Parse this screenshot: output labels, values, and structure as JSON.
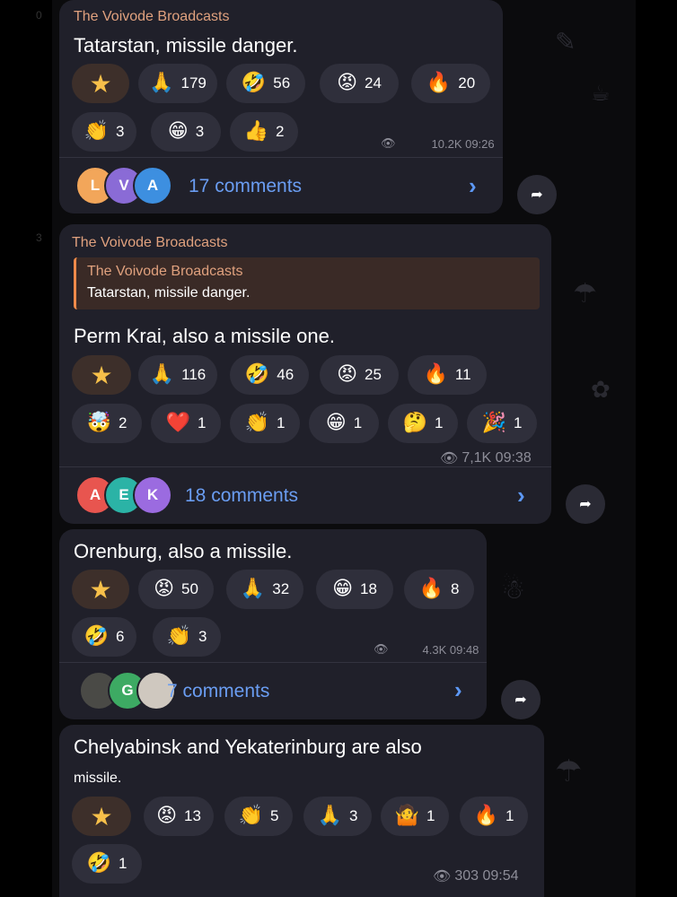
{
  "channel_name": "The Voivode Broadcasts",
  "colors": {
    "bubble": "#20202a",
    "link": "#6a9df2",
    "channel": "#e0a17e",
    "reply_bar": "#f08a4a"
  },
  "icons": {
    "star": "star-icon",
    "eye": "views-eye-icon",
    "forward": "forward-arrow-icon",
    "chevron": "chevron-right-icon"
  },
  "posts": [
    {
      "text": "Tatarstan, missile danger.",
      "reactions": [
        {
          "emoji": "⭐",
          "count": ""
        },
        {
          "emoji": "🙏",
          "count": "179"
        },
        {
          "emoji": "🤣",
          "count": "56"
        },
        {
          "emoji": "😡",
          "count": "24"
        },
        {
          "emoji": "🔥",
          "count": "20"
        },
        {
          "emoji": "👏",
          "count": "3"
        },
        {
          "emoji": "😁",
          "count": "3"
        },
        {
          "emoji": "👍",
          "count": "2"
        }
      ],
      "views": "10.2K 09:26",
      "avatars": [
        "L",
        "V",
        "A"
      ],
      "comments": "17 comments"
    },
    {
      "reply_name": "The Voivode Broadcasts",
      "reply_text": "Tatarstan, missile danger.",
      "text": "Perm Krai, also a missile one.",
      "reactions": [
        {
          "emoji": "⭐",
          "count": ""
        },
        {
          "emoji": "🙏",
          "count": "116"
        },
        {
          "emoji": "🤣",
          "count": "46"
        },
        {
          "emoji": "😡",
          "count": "25"
        },
        {
          "emoji": "🔥",
          "count": "11"
        },
        {
          "emoji": "🤯",
          "count": "2"
        },
        {
          "emoji": "❤️",
          "count": "1"
        },
        {
          "emoji": "👏",
          "count": "1"
        },
        {
          "emoji": "😁",
          "count": "1"
        },
        {
          "emoji": "🤔",
          "count": "1"
        },
        {
          "emoji": "🎉",
          "count": "1"
        }
      ],
      "views": "7,1K 09:38",
      "avatars": [
        "A",
        "E",
        "K"
      ],
      "comments": "18 comments"
    },
    {
      "text": "Orenburg, also a missile.",
      "reactions": [
        {
          "emoji": "⭐",
          "count": ""
        },
        {
          "emoji": "😡",
          "count": "50"
        },
        {
          "emoji": "🙏",
          "count": "32"
        },
        {
          "emoji": "😁",
          "count": "18"
        },
        {
          "emoji": "🔥",
          "count": "8"
        },
        {
          "emoji": "🤣",
          "count": "6"
        },
        {
          "emoji": "👏",
          "count": "3"
        }
      ],
      "views": "4.3K 09:48",
      "avatars": [
        "",
        "G",
        ""
      ],
      "comments": "7 comments"
    },
    {
      "text": "Chelyabinsk and Yekaterinburg are also",
      "text2": "missile.",
      "reactions": [
        {
          "emoji": "⭐",
          "count": ""
        },
        {
          "emoji": "😡",
          "count": "13"
        },
        {
          "emoji": "👏",
          "count": "5"
        },
        {
          "emoji": "🙏",
          "count": "3"
        },
        {
          "emoji": "🤷",
          "count": "1"
        },
        {
          "emoji": "🔥",
          "count": "1"
        },
        {
          "emoji": "🤣",
          "count": "1"
        }
      ],
      "views": "303 09:54"
    }
  ]
}
